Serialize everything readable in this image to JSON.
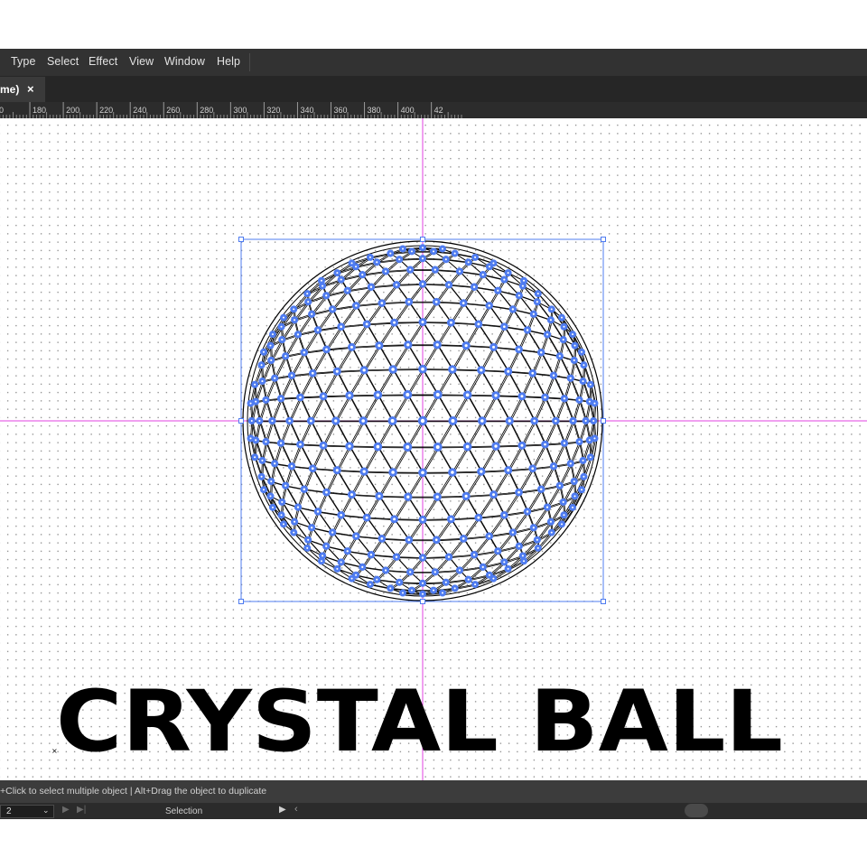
{
  "menubar": {
    "items": [
      "Type",
      "Select",
      "Effect",
      "View",
      "Window",
      "Help"
    ]
  },
  "document_tab": {
    "title": "me)",
    "close_glyph": "×"
  },
  "ruler": {
    "labels": [
      "0",
      "180",
      "200",
      "220",
      "240",
      "260",
      "280",
      "300",
      "320",
      "340",
      "360",
      "380",
      "400",
      "42"
    ]
  },
  "canvas": {
    "heading": "CRYSTAL BALL",
    "artwork": "geodesic-sphere-icon",
    "guide_color": "#e040e0",
    "selection_color": "#4f7cf0"
  },
  "statusbar": {
    "hint": "+Click to select multiple object  |  Alt+Drag the object to duplicate"
  },
  "bottombar": {
    "zoom_value": "2",
    "tool_mode": "Selection"
  },
  "colors": {
    "menubar_bg": "#323232",
    "tab_bg": "#262626",
    "status_bg": "#3c3c3c",
    "anchor_blue": "#4f7cf0"
  }
}
